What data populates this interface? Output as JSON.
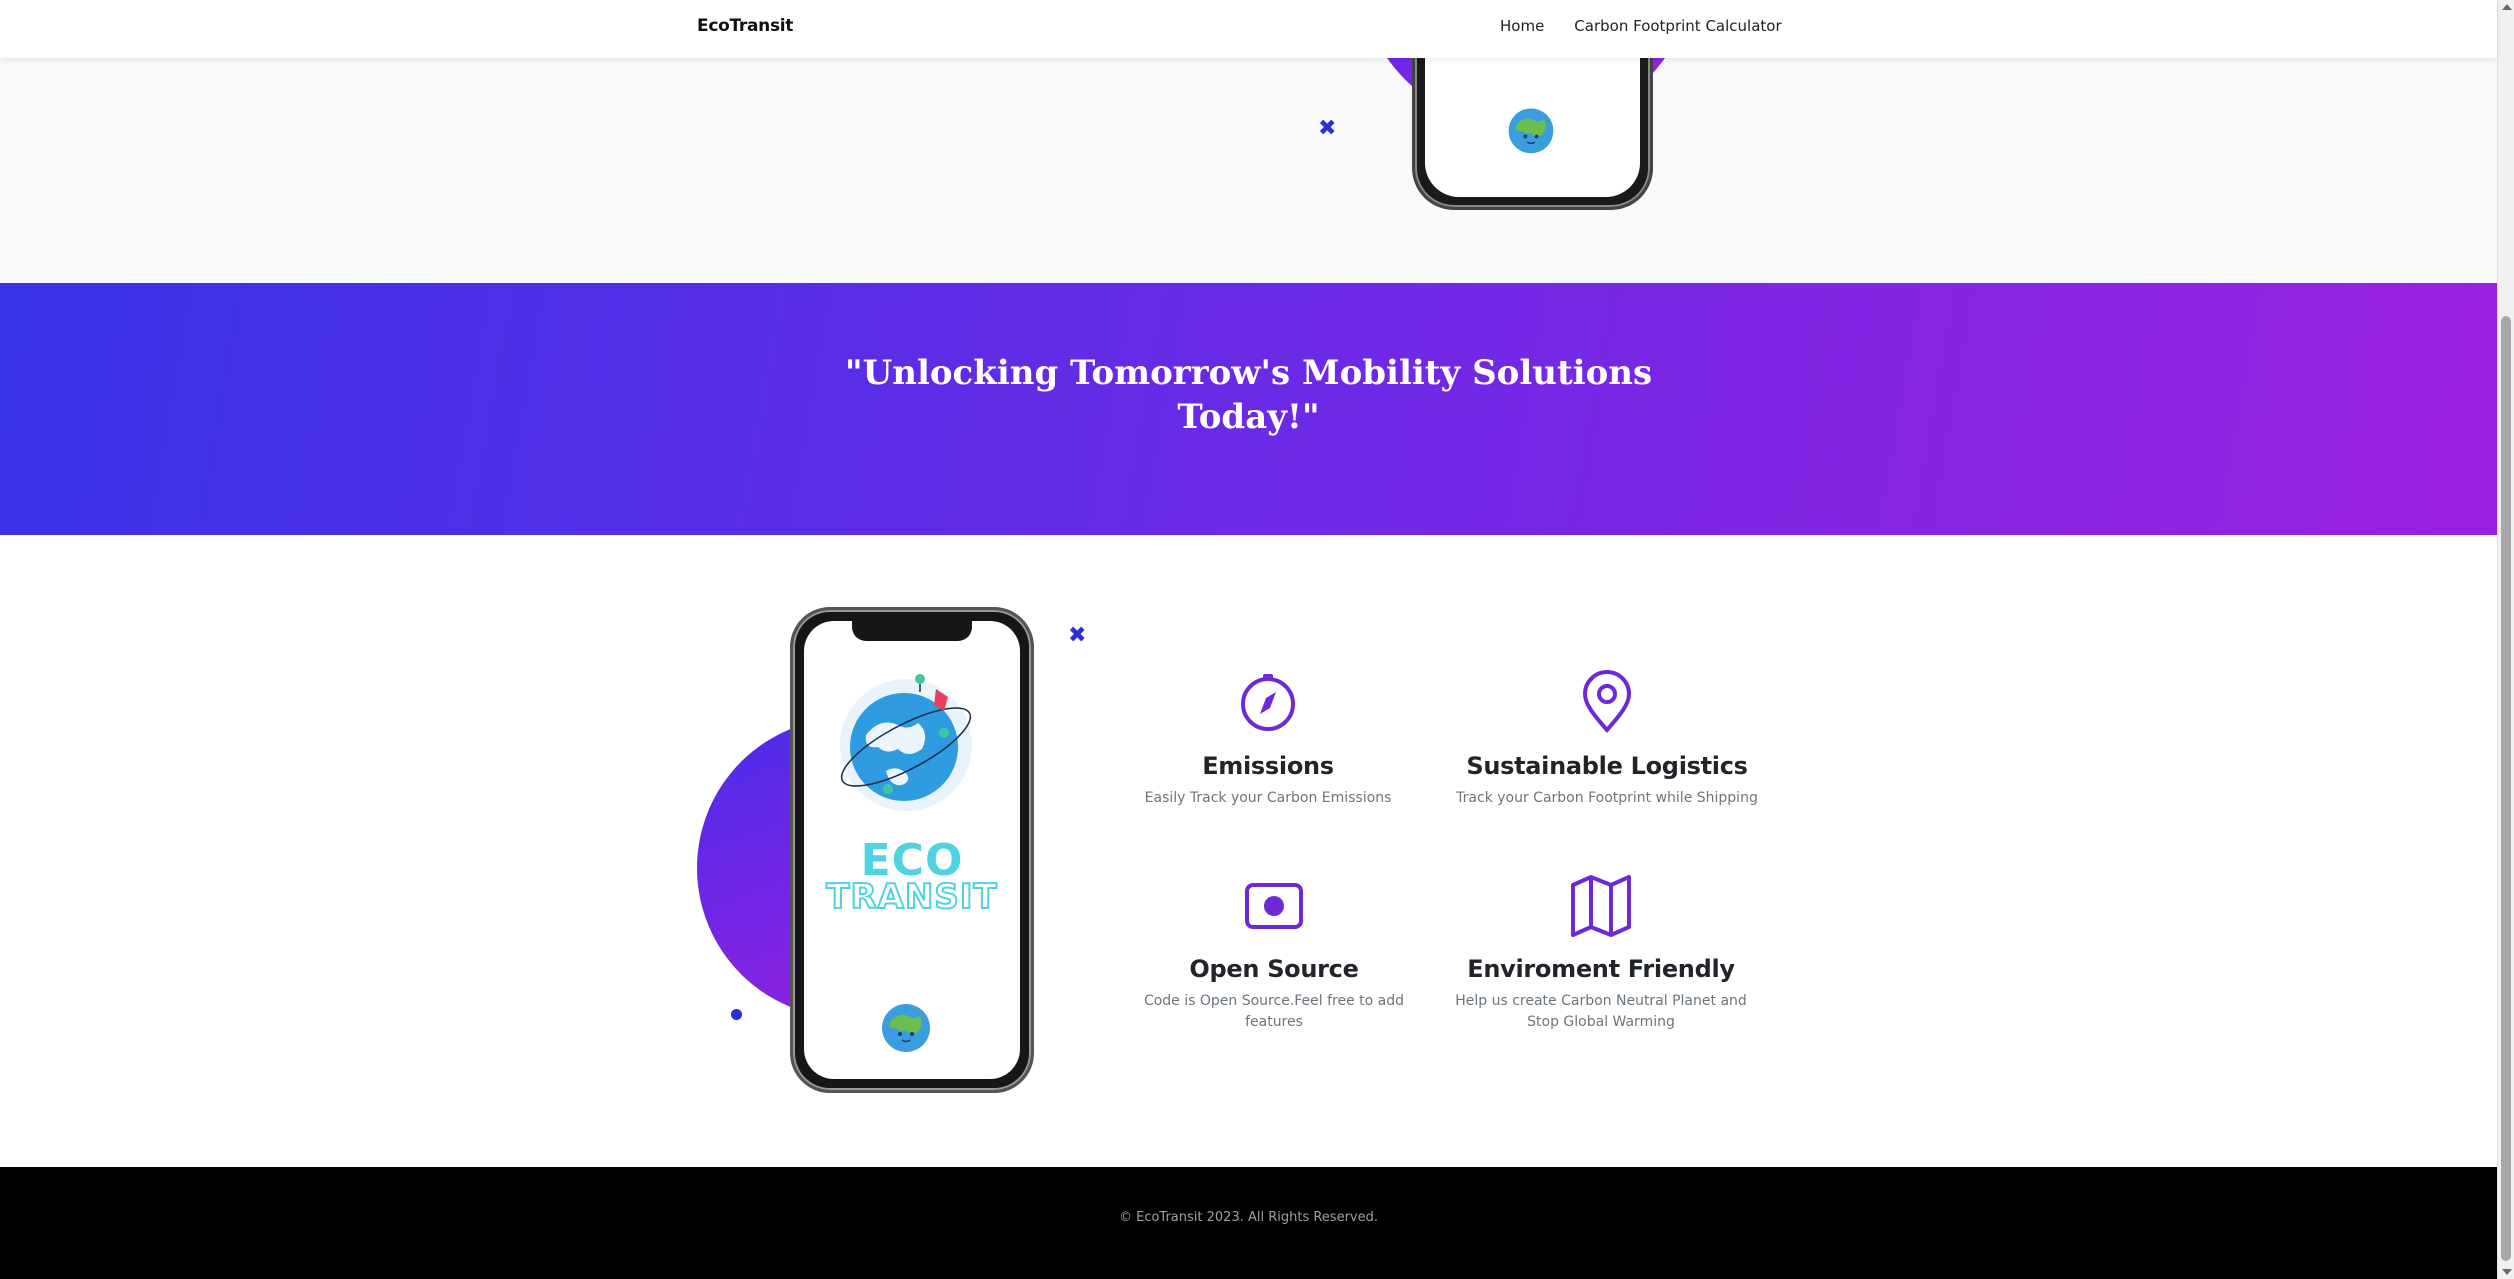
{
  "navbar": {
    "brand": "EcoTransit",
    "links": [
      {
        "label": "Home"
      },
      {
        "label": "Carbon Footprint Calculator"
      }
    ]
  },
  "banner": {
    "quote_line1": "\"Unlocking Tomorrow's Mobility Solutions",
    "quote_line2": "Today!\""
  },
  "phone": {
    "logo_line1": "ECO",
    "logo_line2": "TRANSIT"
  },
  "features": [
    {
      "icon": "compass-icon",
      "title": "Emissions",
      "description": "Easily Track your Carbon Emissions"
    },
    {
      "icon": "map-pin-icon",
      "title": "Sustainable Logistics",
      "description": "Track your Carbon Footprint while Shipping"
    },
    {
      "icon": "record-icon",
      "title": "Open Source",
      "description": "Code is Open Source.Feel free to add features"
    },
    {
      "icon": "map-icon",
      "title": "Enviroment Friendly",
      "description": "Help us create Carbon Neutral Planet and Stop Global Warming"
    }
  ],
  "footer": {
    "copyright": "© EcoTransit 2023. All Rights Reserved."
  },
  "colors": {
    "accent_purple": "#6d28d9",
    "gradient_start": "#3a33e8",
    "gradient_end": "#9a20e0",
    "eco_cyan": "#4fd3e0"
  }
}
